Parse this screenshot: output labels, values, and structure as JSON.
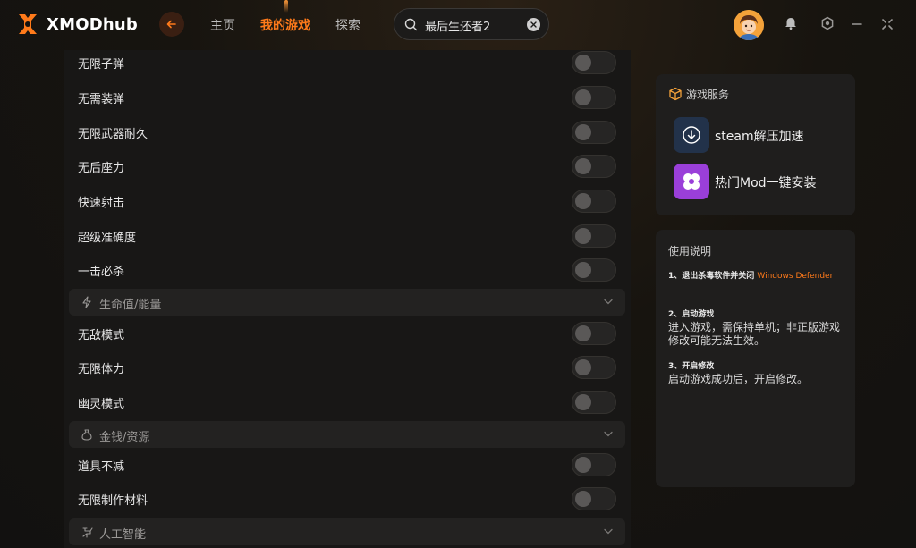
{
  "app": {
    "name": "XMODhub"
  },
  "nav": {
    "items": [
      {
        "label": "主页",
        "active": false
      },
      {
        "label": "我的游戏",
        "active": true
      },
      {
        "label": "探索",
        "active": false
      }
    ]
  },
  "search": {
    "value": "最后生还者2"
  },
  "colors": {
    "accent": "#ff7a1a",
    "background": "#141210",
    "panel": "#181716"
  },
  "icons": {
    "back": "arrow-left-icon",
    "search": "search-icon",
    "clear": "clear-icon",
    "notification": "bell-icon",
    "settings": "gear-icon",
    "minimize": "minimize-icon",
    "close": "close-icon"
  },
  "cheats": {
    "rows_top": [
      {
        "label": "无限子弹",
        "enabled": false
      },
      {
        "label": "无需装弹",
        "enabled": false
      },
      {
        "label": "无限武器耐久",
        "enabled": false
      },
      {
        "label": "无后座力",
        "enabled": false
      },
      {
        "label": "快速射击",
        "enabled": false
      },
      {
        "label": "超级准确度",
        "enabled": false
      },
      {
        "label": "一击必杀",
        "enabled": false
      }
    ],
    "section_health": {
      "title": "生命值/能量",
      "icon": "lightning-icon"
    },
    "rows_health": [
      {
        "label": "无敌模式",
        "enabled": false
      },
      {
        "label": "无限体力",
        "enabled": false
      },
      {
        "label": "幽灵模式",
        "enabled": false
      }
    ],
    "section_money": {
      "title": "金钱/资源",
      "icon": "money-bag-icon"
    },
    "rows_money": [
      {
        "label": "道具不减",
        "enabled": false
      },
      {
        "label": "无限制作材料",
        "enabled": false
      }
    ],
    "section_ai": {
      "title": "人工智能",
      "icon": "ai-robot-icon"
    }
  },
  "services": {
    "title": "游戏服务",
    "items": [
      {
        "label": "steam解压加速",
        "icon": "download-icon"
      },
      {
        "label": "热门Mod一键安装",
        "icon": "mod-icon"
      }
    ]
  },
  "instructions": {
    "title": "使用说明",
    "steps": [
      {
        "heading": "1、退出杀毒软件并关闭",
        "highlight": "Windows Defender",
        "body": ""
      },
      {
        "heading": "2、启动游戏",
        "highlight": "",
        "body": "进入游戏，需保持单机；非正版游戏修改可能无法生效。"
      },
      {
        "heading": "3、开启修改",
        "highlight": "",
        "body": "启动游戏成功后，开启修改。"
      }
    ]
  }
}
